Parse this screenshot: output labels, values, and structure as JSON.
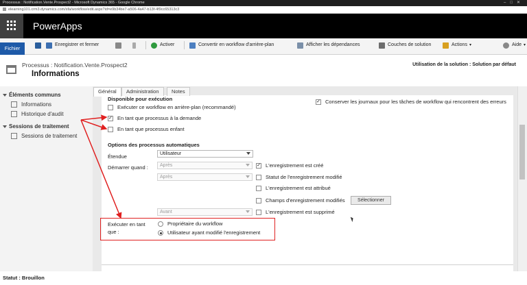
{
  "browser": {
    "window_title": "Processus : Notification.Vente.Prospect2 - Microsoft Dynamics 365 - Google Chrome",
    "url": "elearning101.crm3.dynamics.com/sfa/workflow/edit.aspx?id=e9b34be7-a506-4a47-b13f-4f9cc65313c3"
  },
  "app": {
    "name": "PowerApps"
  },
  "ribbon": {
    "file_tab": "Fichier",
    "save_close": "Enregistrer et fermer",
    "activate": "Activer",
    "convert": "Convertir en workflow d'arrière-plan",
    "show_dependencies": "Afficher les dépendances",
    "solution_layers": "Couches de solution",
    "actions": "Actions",
    "help": "Aide"
  },
  "header": {
    "breadcrumb": "Processus : Notification.Vente.Prospect2",
    "title": "Informations",
    "solution": "Utilisation de la solution : Solution par défaut"
  },
  "nav": {
    "common_header": "Éléments communs",
    "common_items": [
      "Informations",
      "Historique d'audit"
    ],
    "sessions_header": "Sessions de traitement",
    "sessions_items": [
      "Sessions de traitement"
    ]
  },
  "tabs": [
    "Général",
    "Administration",
    "Notes"
  ],
  "form": {
    "available_section": "Disponible pour exécution",
    "run_background": "Exécuter ce workflow en arrière-plan (recommandé)",
    "on_demand": "En tant que processus à la demande",
    "child_process": "En tant que processus enfant",
    "keep_logs": "Conserver les journaux pour les tâches de workflow qui rencontrent des erreurs",
    "auto_section": "Options des processus automatiques",
    "scope_label": "Étendue",
    "scope_value": "Utilisateur",
    "start_when_label": "Démarrer quand :",
    "after_1": "Après",
    "after_2": "Après",
    "before": "Avant",
    "record_created": "L'enregistrement est créé",
    "status_changed": "Statut de l'enregistrement modifié",
    "record_assigned": "L'enregistrement est attribué",
    "fields_changed": "Champs d'enregistrement modifiés",
    "select_button": "Sélectionner",
    "record_deleted": "L'enregistrement est supprimé",
    "run_as_label_1": "Exécuter en tant",
    "run_as_label_2": "que :",
    "owner_option": "Propriétaire du workflow",
    "user_option": "Utilisateur ayant modifié l'enregistrement"
  },
  "checkbox_states": {
    "run_background": false,
    "on_demand": true,
    "child_process": false,
    "keep_logs": true,
    "record_created": true,
    "status_changed": false,
    "record_assigned": false,
    "fields_changed": false,
    "record_deleted": false
  },
  "run_as_selected": "user",
  "status": "Statut : Brouillon",
  "colors": {
    "brand": "#1e5aa8",
    "annotation": "#e02020",
    "appbar": "#000000"
  }
}
